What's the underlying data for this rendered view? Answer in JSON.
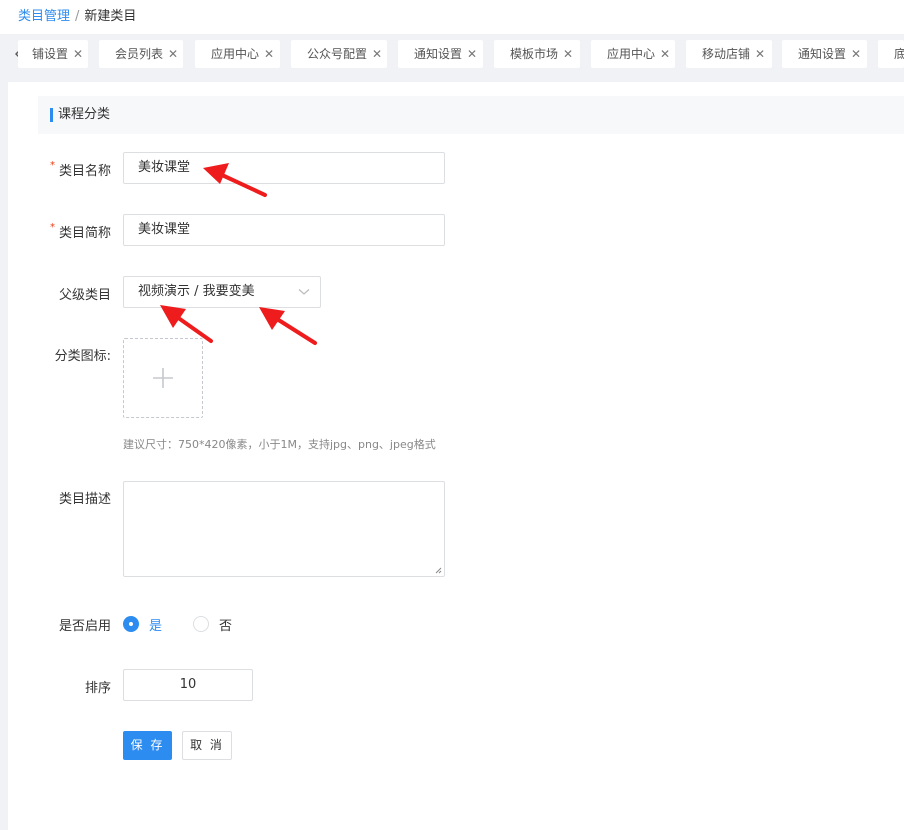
{
  "breadcrumb": {
    "parent": "类目管理",
    "separator": "/",
    "current": "新建类目"
  },
  "tabs": [
    {
      "label": "铺设置"
    },
    {
      "label": "会员列表"
    },
    {
      "label": "应用中心"
    },
    {
      "label": "公众号配置"
    },
    {
      "label": "通知设置"
    },
    {
      "label": "模板市场"
    },
    {
      "label": "应用中心"
    },
    {
      "label": "移动店铺"
    },
    {
      "label": "通知设置"
    },
    {
      "label": "底"
    }
  ],
  "form": {
    "section_title": "课程分类",
    "name": {
      "label": "类目名称",
      "value": "美妆课堂"
    },
    "short_name": {
      "label": "类目简称",
      "value": "美妆课堂"
    },
    "parent": {
      "label": "父级类目",
      "value": "视频演示 / 我要变美"
    },
    "icon": {
      "label": "分类图标:",
      "hint": "建议尺寸：750*420像素，小于1M，支持jpg、png、jpeg格式"
    },
    "description": {
      "label": "类目描述",
      "value": ""
    },
    "enabled": {
      "label": "是否启用",
      "options": [
        "是",
        "否"
      ],
      "selected": "是"
    },
    "sort": {
      "label": "排序",
      "value": "10"
    },
    "save_label": "保 存",
    "cancel_label": "取 消"
  },
  "colors": {
    "accent": "#2d8cf0",
    "required": "#ed4014",
    "annotation": "#ee1c1c"
  }
}
